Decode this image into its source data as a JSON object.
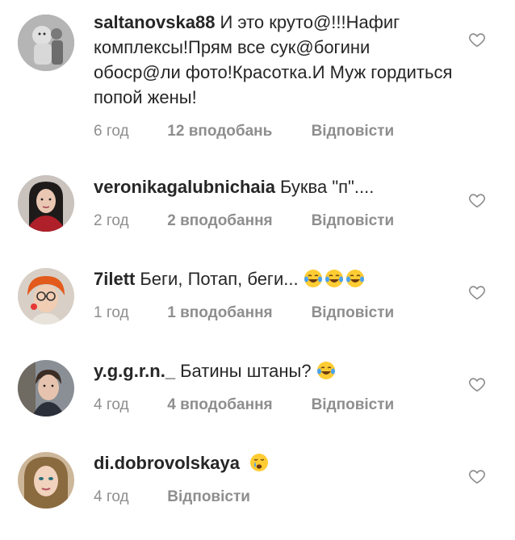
{
  "comments": [
    {
      "username": "saltanovska88",
      "text": "И это круто@!!!Нафиг комплексы!Прям все сук@богини обоср@ли фото!Красотка.И Муж гордиться попой жены!",
      "time": "6 год",
      "likes": "12 вподобань",
      "reply": "Відповісти",
      "avatar_icon": "doll-figure-avatar"
    },
    {
      "username": "veronikagalubnichaia",
      "text": "Буква \"п\"....",
      "time": "2 год",
      "likes": "2 вподобання",
      "reply": "Відповісти",
      "avatar_icon": "woman-dark-hair-avatar"
    },
    {
      "username": "7ilett",
      "text": "Беги, Потап, беги...",
      "emojis": [
        "tears-of-joy-emoji",
        "tears-of-joy-emoji",
        "tears-of-joy-emoji"
      ],
      "time": "1 год",
      "likes": "1 вподобання",
      "reply": "Відповісти",
      "avatar_icon": "woman-red-hair-glasses-avatar"
    },
    {
      "username": "y.g.g.r.n._",
      "text": "Батины штаны?",
      "emojis": [
        "tears-of-joy-emoji"
      ],
      "time": "4 год",
      "likes": "4 вподобання",
      "reply": "Відповісти",
      "avatar_icon": "man-portrait-avatar"
    },
    {
      "username": "di.dobrovolskaya",
      "text": "",
      "emojis": [
        "crying-face-emoji"
      ],
      "time": "4 год",
      "likes": "",
      "reply": "Відповісти",
      "avatar_icon": "woman-blonde-avatar"
    }
  ],
  "colors": {
    "primary_text": "#262626",
    "secondary_text": "#8e8e8e",
    "heart_outline": "#8e8e8e"
  },
  "icons": {
    "like": "heart-outline-icon"
  }
}
